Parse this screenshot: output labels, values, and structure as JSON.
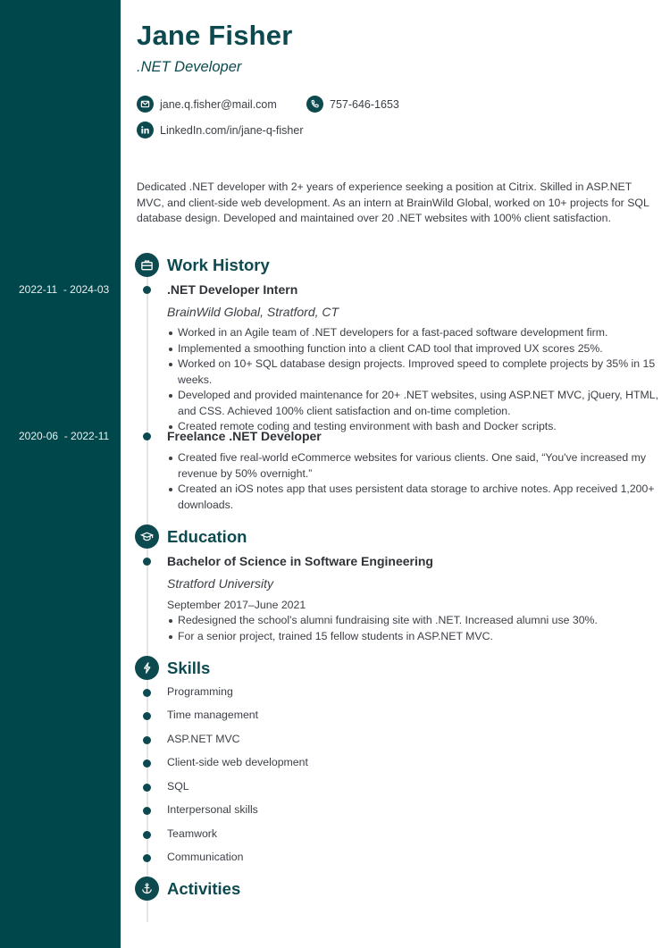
{
  "header": {
    "name": "Jane Fisher",
    "role": ".NET Developer",
    "contacts": {
      "email": {
        "icon": "mail-icon",
        "text": "jane.q.fisher@mail.com"
      },
      "phone": {
        "icon": "phone-icon",
        "text": "757-646-1653"
      },
      "linkedin": {
        "icon": "linkedin-icon",
        "text": "LinkedIn.com/in/jane-q-fisher"
      }
    }
  },
  "summary": "Dedicated .NET developer with 2+ years of experience seeking a position at Citrix. Skilled in ASP.NET MVC, and client-side web development. As an intern at BrainWild Global, worked on 10+ projects for SQL database design. Developed and maintained over 20 .NET websites with 100% client satisfaction.",
  "colors": {
    "accent": "#0d4a4f",
    "sidebar": "#00474c"
  },
  "work_history": {
    "title": "Work History",
    "icon": "briefcase-icon",
    "jobs": [
      {
        "dates": "2022-11  - 2024-03",
        "title": ".NET Developer Intern",
        "company": "BrainWild Global, Stratford, CT",
        "bullets": [
          "Worked in an Agile team of .NET developers for a fast-paced software development firm.",
          "Implemented a smoothing function into a client CAD tool that improved UX scores 25%.",
          "Worked on 10+ SQL database design projects. Improved speed to complete projects by 35% in 15 weeks.",
          "Developed and provided maintenance for 20+ .NET websites, using ASP.NET MVC, jQuery, HTML, and CSS. Achieved 100% client satisfaction and on-time completion.",
          "Created remote coding and testing environment with bash and Docker scripts."
        ]
      },
      {
        "dates": "2020-06  - 2022-11",
        "title": "Freelance .NET Developer",
        "bullets": [
          "Created five real-world eCommerce websites for various clients. One said, “You've increased my revenue by 50% overnight.”",
          "Created an iOS notes app that uses persistent data storage to archive notes. App received 1,200+ downloads."
        ]
      }
    ]
  },
  "education": {
    "title": "Education",
    "icon": "graduation-cap-icon",
    "degree": "Bachelor of Science in Software Engineering",
    "school": "Stratford University",
    "dates": "September 2017–June 2021",
    "bullets": [
      "Redesigned the school's alumni fundraising site with .NET. Increased alumni use 30%.",
      "For a senior project, trained 15 fellow students in ASP.NET MVC."
    ]
  },
  "skills": {
    "title": "Skills",
    "icon": "lightning-icon",
    "items": [
      "Programming",
      "Time management",
      "ASP.NET MVC",
      "Client-side web development",
      "SQL",
      "Interpersonal skills",
      "Teamwork",
      "Communication"
    ]
  },
  "activities": {
    "title": "Activities",
    "icon": "anchor-icon"
  }
}
